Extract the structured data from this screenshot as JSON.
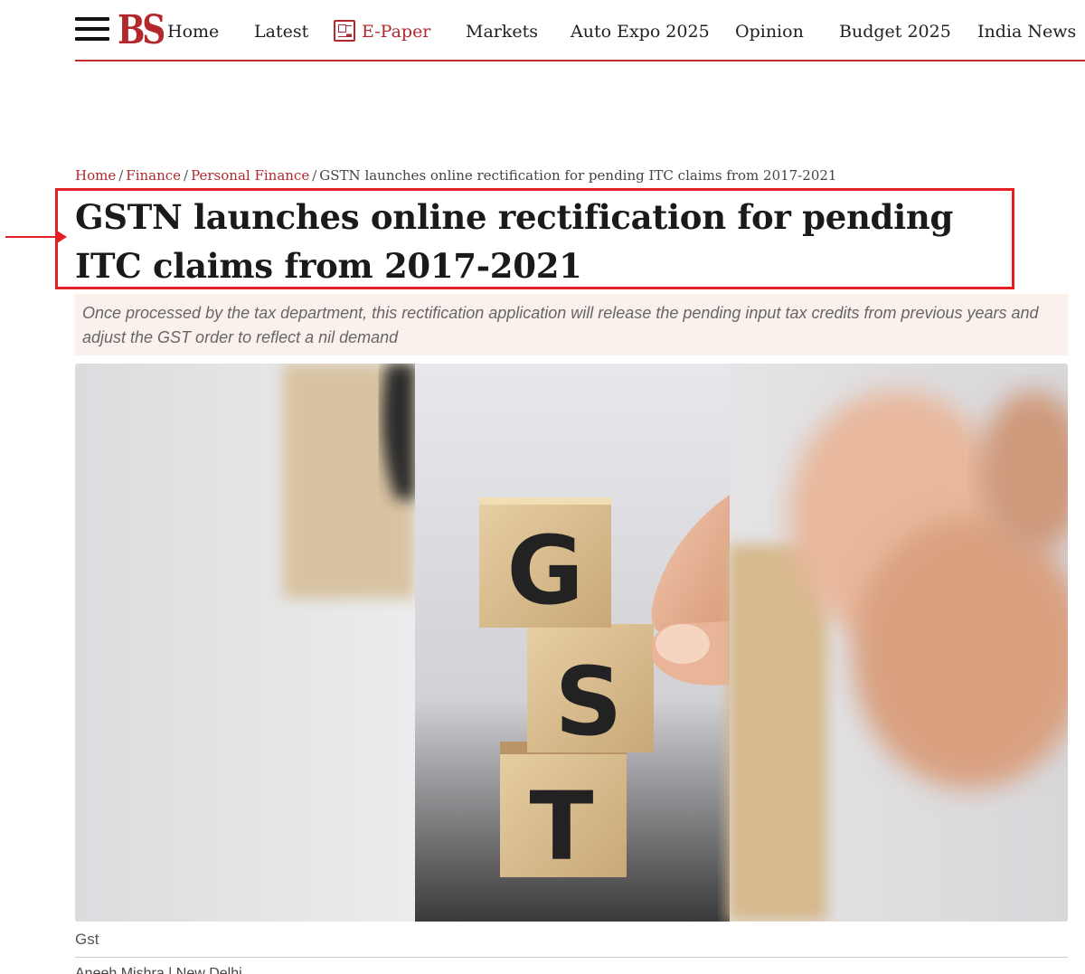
{
  "header": {
    "logo_text": "BS",
    "nav": [
      {
        "label": "Home"
      },
      {
        "label": "Latest"
      },
      {
        "label": "E-Paper"
      },
      {
        "label": "Markets"
      },
      {
        "label": "Auto Expo 2025"
      },
      {
        "label": "Opinion"
      },
      {
        "label": "Budget 2025"
      },
      {
        "label": "India News"
      }
    ]
  },
  "breadcrumb": {
    "items": [
      "Home",
      "Finance",
      "Personal Finance"
    ],
    "separator": "/",
    "current": "GSTN launches online rectification for pending ITC claims from 2017-2021"
  },
  "article": {
    "headline": "GSTN launches online rectification for pending ITC claims from 2017-2021",
    "summary": "Once processed by the tax department, this rectification application will release the pending input tax credits from previous years and adjust the GST order to reflect a nil demand",
    "image_letters": [
      "G",
      "S",
      "T"
    ],
    "image_caption": "Gst",
    "byline": "Aneeh Mishra | New Delhi"
  },
  "colors": {
    "brand_red": "#b3282d",
    "annotation_red": "#e31e24",
    "summary_bg": "#fbf1ec"
  },
  "icons": {
    "menu": "hamburger-icon",
    "epaper": "newspaper-icon",
    "annotation": "arrow-right-icon"
  }
}
